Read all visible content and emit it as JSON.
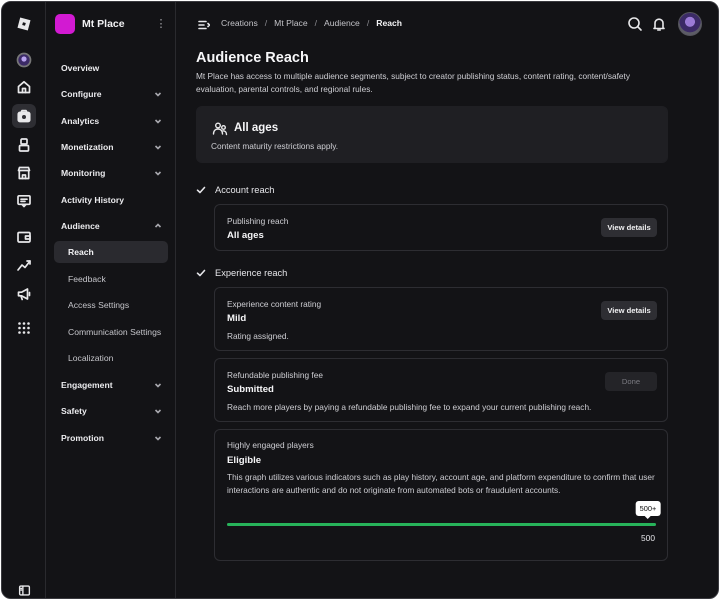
{
  "app": {
    "logo_icon": "roblox-logo-icon"
  },
  "rail": {
    "items": [
      {
        "name": "profile-avatar-icon"
      },
      {
        "name": "home-icon"
      },
      {
        "name": "creations-icon",
        "active": true
      },
      {
        "name": "avatar-creator-icon"
      },
      {
        "name": "marketplace-icon"
      },
      {
        "name": "messages-icon"
      },
      {
        "name": "wallet-icon"
      },
      {
        "name": "analytics-icon"
      },
      {
        "name": "ads-megaphone-icon"
      },
      {
        "name": "more-apps-icon"
      }
    ],
    "bottom": {
      "name": "collapse-panel-icon"
    }
  },
  "sidebar": {
    "experience_name": "Mt Place",
    "experience_color": "#d21ad2",
    "items": [
      {
        "label": "Overview",
        "chevron": false
      },
      {
        "label": "Configure",
        "chevron": true
      },
      {
        "label": "Analytics",
        "chevron": true
      },
      {
        "label": "Monetization",
        "chevron": true
      },
      {
        "label": "Monitoring",
        "chevron": true
      },
      {
        "label": "Activity History",
        "chevron": false
      },
      {
        "label": "Audience",
        "chevron": true
      }
    ],
    "audience_sub": [
      {
        "label": "Reach",
        "active": true
      },
      {
        "label": "Feedback"
      },
      {
        "label": "Access Settings"
      },
      {
        "label": "Communication Settings"
      },
      {
        "label": "Localization"
      }
    ],
    "items_after": [
      {
        "label": "Engagement",
        "chevron": true
      },
      {
        "label": "Safety",
        "chevron": true
      },
      {
        "label": "Promotion",
        "chevron": true
      }
    ]
  },
  "topbar": {
    "breadcrumb": [
      "Creations",
      "Mt Place",
      "Audience",
      "Reach"
    ],
    "icons": [
      "search-icon",
      "notifications-bell-icon"
    ]
  },
  "page": {
    "title": "Audience Reach",
    "description": "Mt Place has access to multiple audience segments, subject to creator publishing status, content rating, content/safety evaluation, parental controls, and regional rules.",
    "all_ages_card": {
      "title": "All ages",
      "subtitle": "Content maturity restrictions apply."
    },
    "account_reach": {
      "heading": "Account reach",
      "publishing": {
        "label": "Publishing reach",
        "value": "All ages",
        "button": "View details"
      }
    },
    "experience_reach": {
      "heading": "Experience reach",
      "content_rating": {
        "label": "Experience content rating",
        "value": "Mild",
        "note": "Rating assigned.",
        "button": "View details"
      },
      "publishing_fee": {
        "label": "Refundable publishing fee",
        "value": "Submitted",
        "note": "Reach more players by paying a refundable publishing fee to expand your current publishing reach.",
        "button": "Done"
      },
      "engaged_players": {
        "label": "Highly engaged players",
        "value": "Eligible",
        "note": "This graph utilizes various indicators such as play history, account age, and platform expenditure to confirm that user interactions are authentic and do not originate from automated bots or fraudulent accounts.",
        "progress_fraction": 1.0,
        "bar_color": "#27b35a",
        "tooltip": "500+",
        "max_label": "500"
      }
    }
  }
}
